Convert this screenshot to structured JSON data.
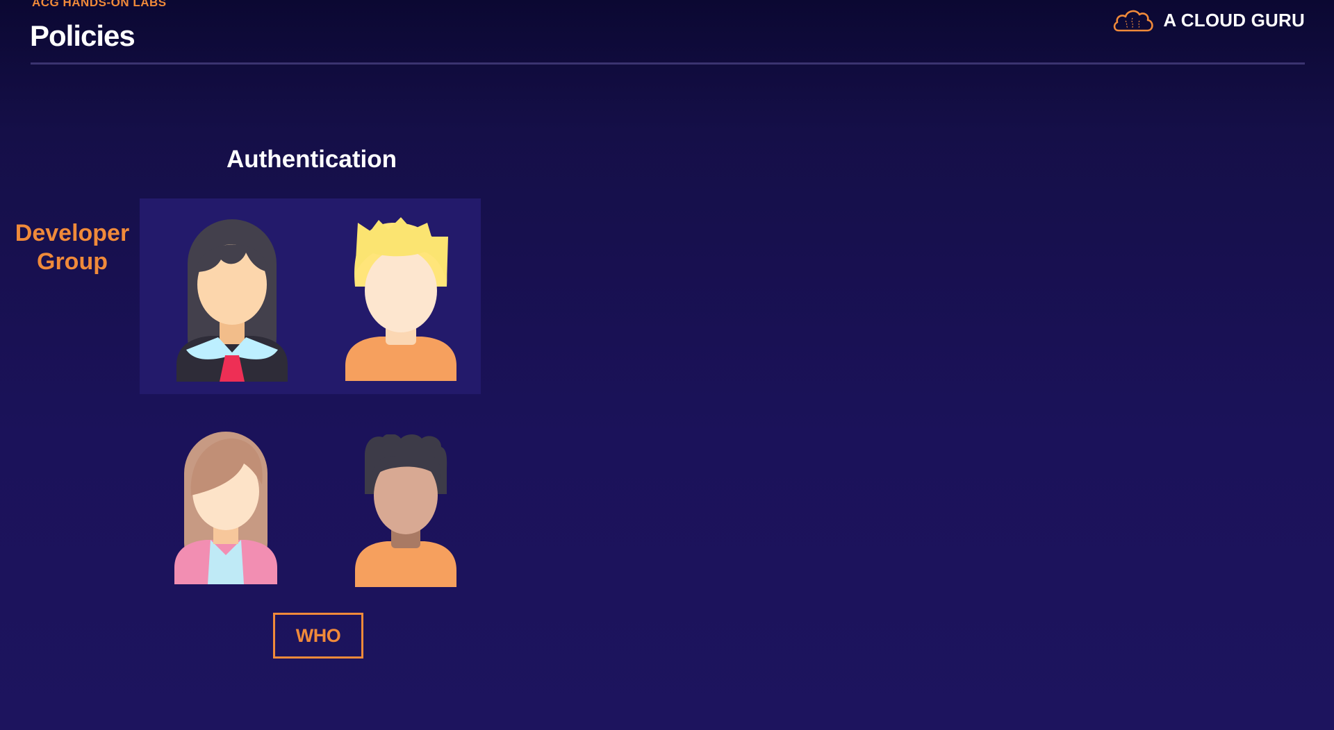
{
  "header": {
    "eyebrow": "ACG HANDS-ON LABS",
    "title": "Policies"
  },
  "brand": {
    "name": "A CLOUD GURU",
    "logo_icon": "cloud-icon"
  },
  "slide": {
    "section_title": "Authentication",
    "group_label_line1": "Developer",
    "group_label_line2": "Group",
    "who_label": "WHO"
  },
  "avatars": [
    {
      "name": "woman-dark-hair-avatar",
      "in_group": true
    },
    {
      "name": "man-blond-hair-avatar",
      "in_group": true
    },
    {
      "name": "woman-brown-hair-avatar",
      "in_group": false
    },
    {
      "name": "man-curly-hair-avatar",
      "in_group": false
    }
  ],
  "colors": {
    "accent": "#f08a3a",
    "background_top": "#0b0832",
    "background_bottom": "#1d145e",
    "group_box": "#231a6b"
  }
}
